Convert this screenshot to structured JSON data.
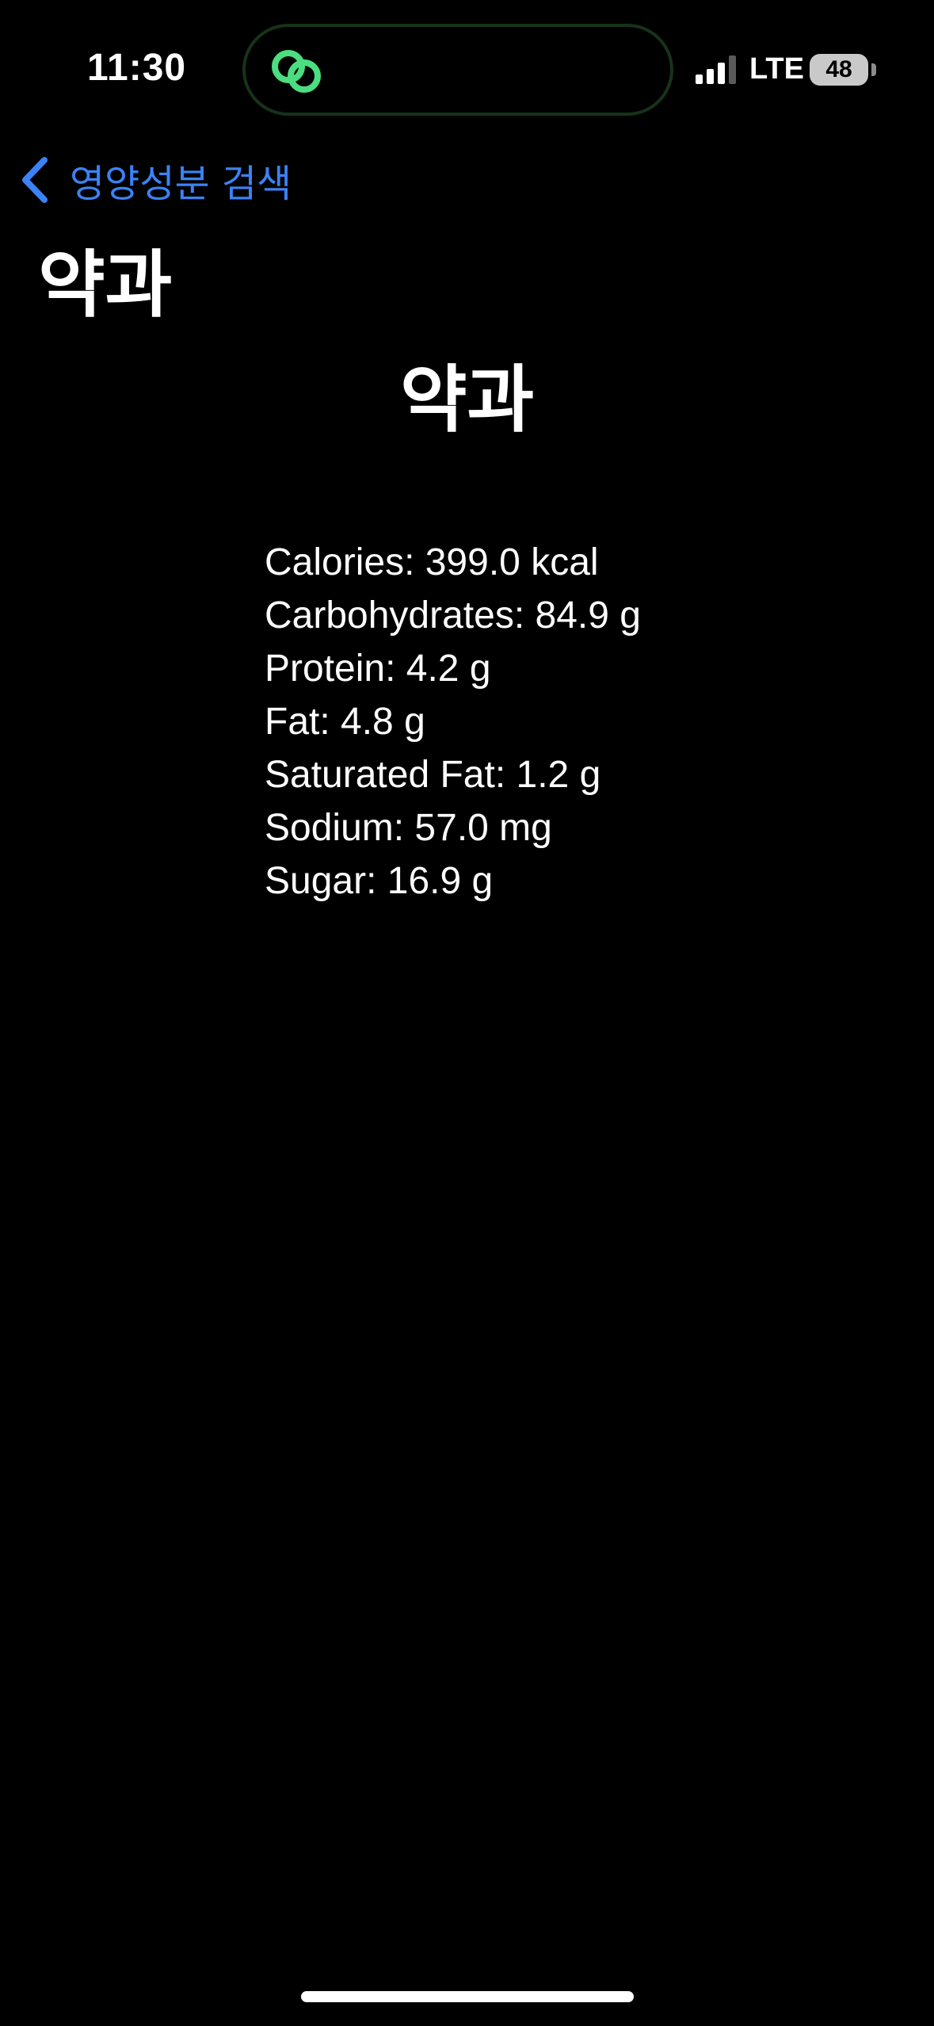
{
  "status_bar": {
    "time": "11:30",
    "carrier": "LTE",
    "battery": "48"
  },
  "nav": {
    "back_label": "영양성분 검색",
    "title": "약과"
  },
  "food": {
    "name": "약과",
    "nutrition": [
      "Calories: 399.0 kcal",
      "Carbohydrates: 84.9 g",
      "Protein: 4.2 g",
      "Fat: 4.8 g",
      "Saturated Fat: 1.2 g",
      "Sodium: 57.0 mg",
      "Sugar: 16.9 g"
    ]
  },
  "icons": {
    "island": "linked-rings-icon",
    "signal": "cellular-signal-icon",
    "back": "chevron-left-icon"
  },
  "colors": {
    "background": "#000000",
    "text": "#ffffff",
    "accent": "#3b82f6",
    "island_icon": "#4ade80"
  }
}
